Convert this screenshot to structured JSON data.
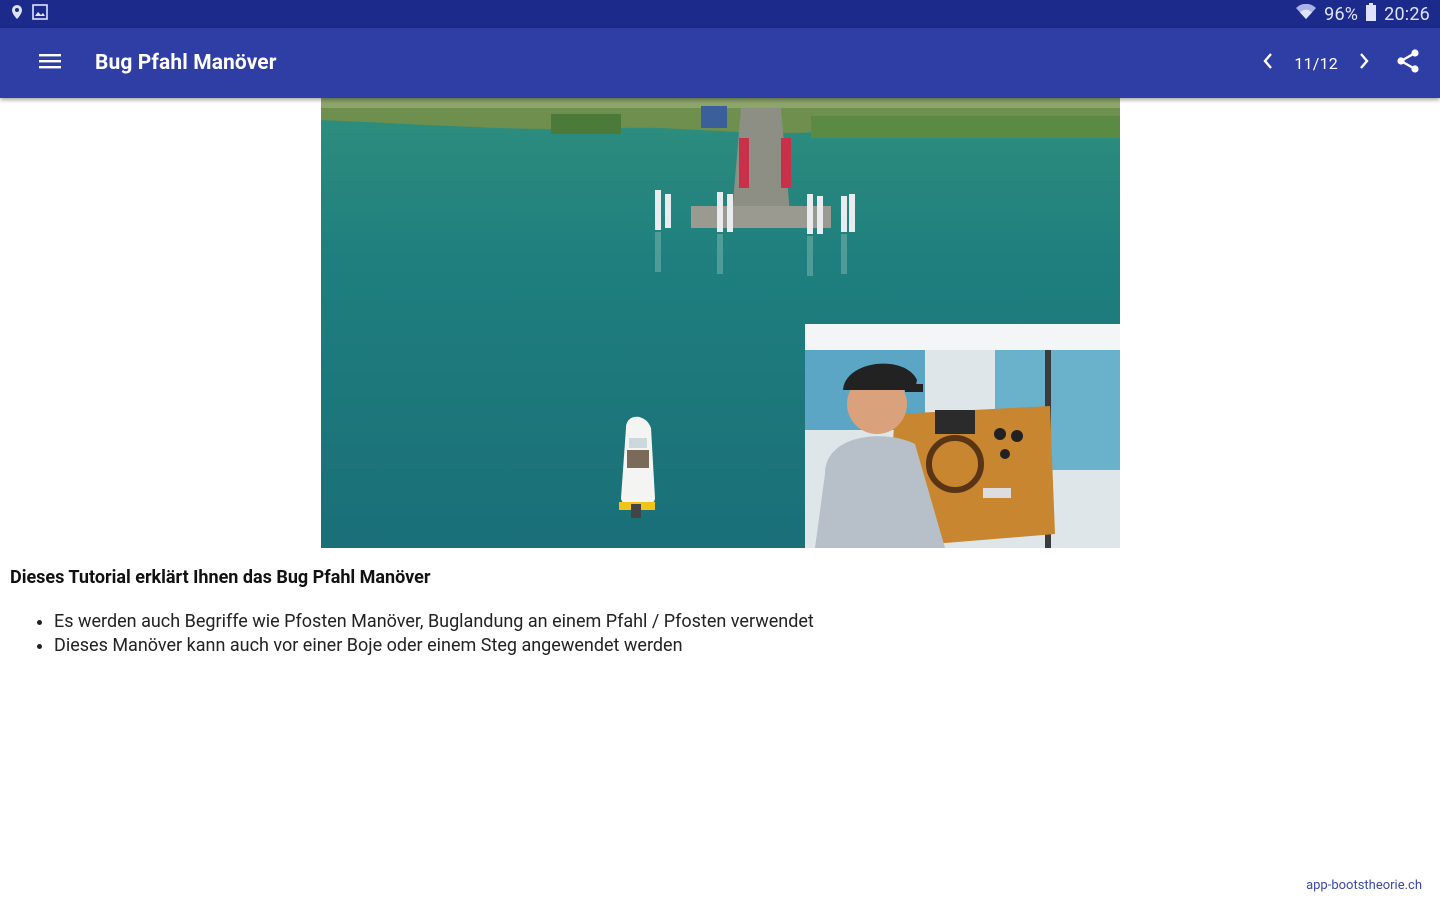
{
  "status_bar": {
    "battery_percent": "96%",
    "time": "20:26",
    "icons": [
      "location-icon",
      "gallery-icon",
      "wifi-icon",
      "battery-icon"
    ]
  },
  "app_bar": {
    "title": "Bug Pfahl Manöver",
    "page_counter": "11/12",
    "icons": [
      "menu-icon",
      "chevron-left-icon",
      "chevron-right-icon",
      "share-icon"
    ]
  },
  "content": {
    "intro": "Dieses Tutorial erklärt Ihnen das Bug Pfahl Manöver",
    "bullets": [
      "Es werden auch Begriffe wie Pfosten Manöver, Buglandung an einem Pfahl / Pfosten verwendet",
      "Dieses Manöver kann auch vor einer Boje oder einem Steg angewendet werden"
    ]
  },
  "footer": {
    "link_text": "app-bootstheorie.ch"
  },
  "colors": {
    "status_bar": "#1c2a8c",
    "app_bar": "#2f3ea4",
    "water": "#1e7a7e",
    "link": "#3949ab"
  }
}
